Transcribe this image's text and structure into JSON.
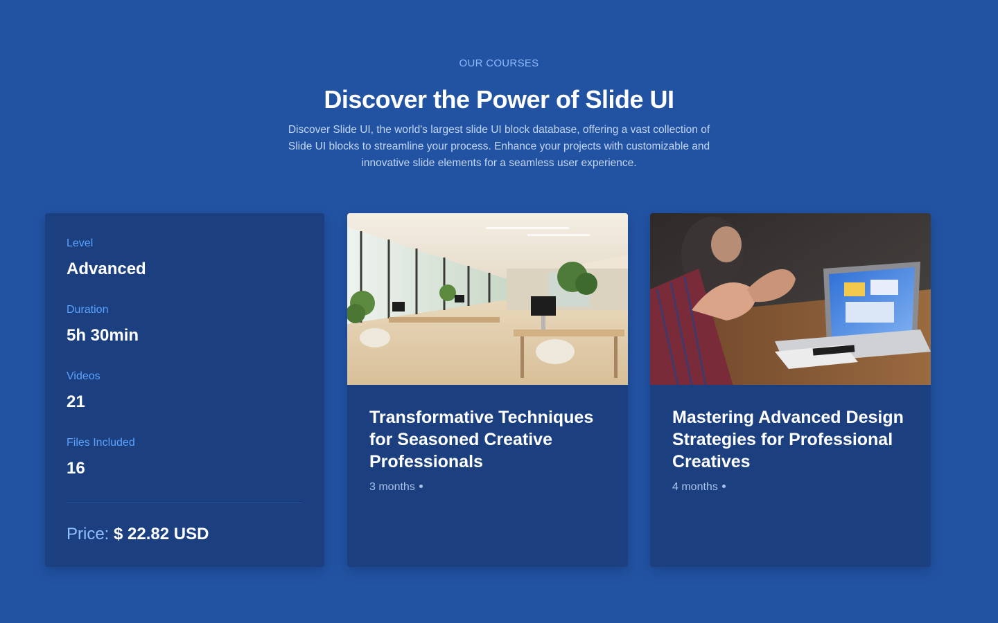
{
  "header": {
    "eyebrow": "OUR COURSES",
    "title": "Discover the Power of Slide UI",
    "description": "Discover Slide UI, the world's largest slide UI block database, offering a vast collection of Slide UI blocks to streamline your process. Enhance your projects with customizable and innovative slide elements for a seamless user experience."
  },
  "course_info": {
    "stats": [
      {
        "label": "Level",
        "value": "Advanced"
      },
      {
        "label": "Duration",
        "value": "5h 30min"
      },
      {
        "label": "Videos",
        "value": "21"
      },
      {
        "label": "Files Included",
        "value": "16"
      }
    ],
    "price_label": "Price:",
    "price_value": "$ 22.82 USD"
  },
  "courses": [
    {
      "title": "Transformative Techniques for Seasoned Creative Professionals",
      "duration": "3 months",
      "image": "office-interior-photo"
    },
    {
      "title": "Mastering Advanced Design Strategies for Professional Creatives",
      "duration": "4 months",
      "image": "laptop-meeting-photo"
    }
  ],
  "colors": {
    "background": "#2253a3",
    "card": "#1b3f7f",
    "accent_label": "#5aa3ff",
    "eyebrow": "#8fb8ff"
  }
}
